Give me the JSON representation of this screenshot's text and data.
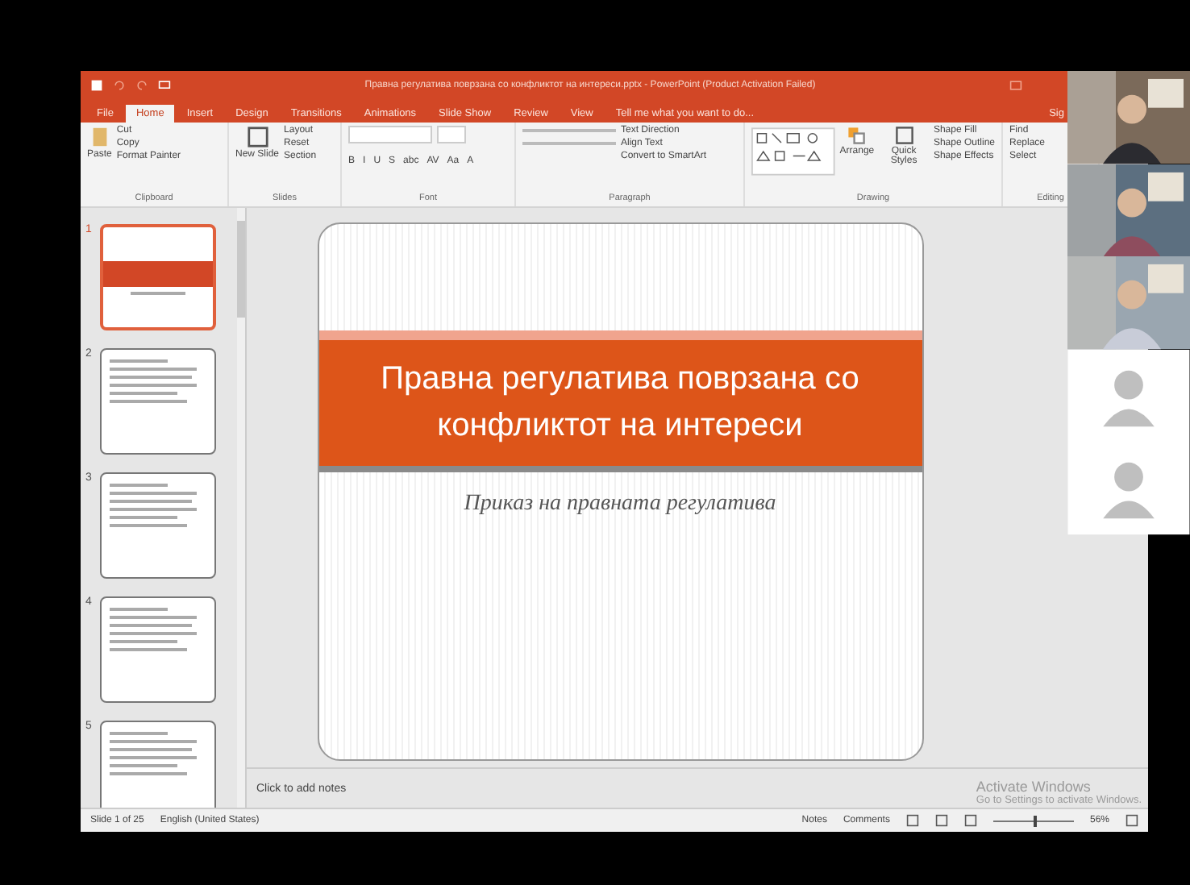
{
  "window": {
    "title": "Правна регулатива поврзана со конфликтот на интереси.pptx - PowerPoint (Product Activation Failed)"
  },
  "menu_tabs": [
    {
      "label": "File",
      "selected": false
    },
    {
      "label": "Home",
      "selected": true
    },
    {
      "label": "Insert",
      "selected": false
    },
    {
      "label": "Design",
      "selected": false
    },
    {
      "label": "Transitions",
      "selected": false
    },
    {
      "label": "Animations",
      "selected": false
    },
    {
      "label": "Slide Show",
      "selected": false
    },
    {
      "label": "Review",
      "selected": false
    },
    {
      "label": "View",
      "selected": false
    }
  ],
  "tell_me": {
    "placeholder": "Tell me what you want to do..."
  },
  "sign_in": "Sig",
  "ribbon": {
    "clipboard": {
      "label": "Clipboard",
      "paste": "Paste",
      "cut": "Cut",
      "copy": "Copy",
      "format_painter": "Format Painter"
    },
    "slides": {
      "label": "Slides",
      "new_slide": "New Slide",
      "layout": "Layout",
      "reset": "Reset",
      "section": "Section"
    },
    "font": {
      "label": "Font",
      "buttons": [
        "B",
        "I",
        "U",
        "S",
        "abc",
        "AV",
        "Aa",
        "A"
      ]
    },
    "paragraph": {
      "label": "Paragraph",
      "text_direction": "Text Direction",
      "align_text": "Align Text",
      "convert": "Convert to SmartArt"
    },
    "drawing": {
      "label": "Drawing",
      "arrange": "Arrange",
      "quick_styles": "Quick Styles",
      "shape_fill": "Shape Fill",
      "shape_outline": "Shape Outline",
      "shape_effects": "Shape Effects"
    },
    "editing": {
      "label": "Editing",
      "find": "Find",
      "replace": "Replace",
      "select": "Select"
    }
  },
  "thumbnails": [
    {
      "number": "1",
      "selected": true,
      "kind": "title"
    },
    {
      "number": "2",
      "selected": false,
      "kind": "bullets"
    },
    {
      "number": "3",
      "selected": false,
      "kind": "bullets"
    },
    {
      "number": "4",
      "selected": false,
      "kind": "bullets"
    },
    {
      "number": "5",
      "selected": false,
      "kind": "bullets"
    }
  ],
  "slide": {
    "title": "Правна регулатива поврзана со конфликтот на интереси",
    "subtitle": "Приказ на правната регулатива"
  },
  "notes": {
    "placeholder": "Click to add notes"
  },
  "activation": {
    "heading": "Activate Windows",
    "text": "Go to Settings to activate Windows."
  },
  "status_bar": {
    "slide": "Slide 1 of 25",
    "language": "English (United States)",
    "notes": "Notes",
    "comments": "Comments",
    "zoom": "56%",
    "zoom_level": {
      "level": 0.5
    }
  },
  "participants": [
    {
      "kind": "camera"
    },
    {
      "kind": "camera"
    },
    {
      "kind": "camera"
    },
    {
      "kind": "avatar"
    },
    {
      "kind": "avatar"
    }
  ]
}
